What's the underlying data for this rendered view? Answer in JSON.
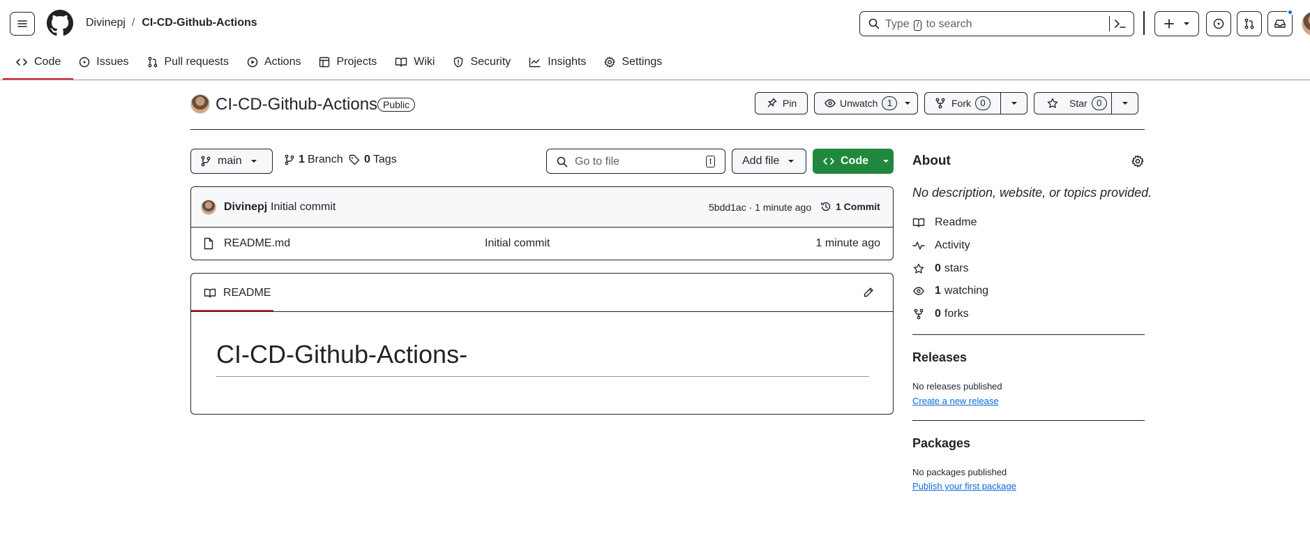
{
  "header": {
    "owner": "Divinepj",
    "separator": "/",
    "repo": "CI-CD-Github-Actions",
    "search_prefix": "Type",
    "search_key": "/",
    "search_suffix": "to search"
  },
  "tabs": [
    {
      "label": "Code",
      "icon": "code-icon",
      "active": true
    },
    {
      "label": "Issues",
      "icon": "issue-opened-icon"
    },
    {
      "label": "Pull requests",
      "icon": "git-pull-request-icon"
    },
    {
      "label": "Actions",
      "icon": "play-icon"
    },
    {
      "label": "Projects",
      "icon": "table-icon"
    },
    {
      "label": "Wiki",
      "icon": "book-icon"
    },
    {
      "label": "Security",
      "icon": "shield-icon"
    },
    {
      "label": "Insights",
      "icon": "graph-icon"
    },
    {
      "label": "Settings",
      "icon": "gear-icon"
    }
  ],
  "repo": {
    "title": "CI-CD-Github-Actions",
    "visibility": "Public",
    "pin_label": "Pin",
    "unwatch_label": "Unwatch",
    "watch_count": "1",
    "fork_label": "Fork",
    "fork_count": "0",
    "star_label": "Star",
    "star_count": "0"
  },
  "toolbar": {
    "branch": "main",
    "branch_count": "1",
    "branch_label": "Branch",
    "tag_count": "0",
    "tag_label": "Tags",
    "goto_placeholder": "Go to file",
    "goto_key": "t",
    "add_file": "Add file",
    "code": "Code"
  },
  "commit": {
    "author": "Divinepj",
    "message": "Initial commit",
    "meta": "5bdd1ac · 1 minute ago",
    "count_label": "1 Commit"
  },
  "files": [
    {
      "name": "README.md",
      "message": "Initial commit",
      "time": "1 minute ago"
    }
  ],
  "readme": {
    "tab_label": "README",
    "heading": "CI-CD-Github-Actions-"
  },
  "sidebar": {
    "about_title": "About",
    "description": "No description, website, or topics provided.",
    "readme": "Readme",
    "activity": "Activity",
    "stars_count": "0",
    "stars_label": "stars",
    "watching_count": "1",
    "watching_label": "watching",
    "forks_count": "0",
    "forks_label": "forks",
    "releases_title": "Releases",
    "releases_text": "No releases published",
    "releases_link": "Create a new release",
    "packages_title": "Packages",
    "packages_text": "No packages published",
    "packages_link": "Publish your first package"
  },
  "colors": {
    "primary_green": "#1f883d",
    "link_blue": "#0969da",
    "active_underline": "#d1242f",
    "notification_dot": "#0969da"
  }
}
